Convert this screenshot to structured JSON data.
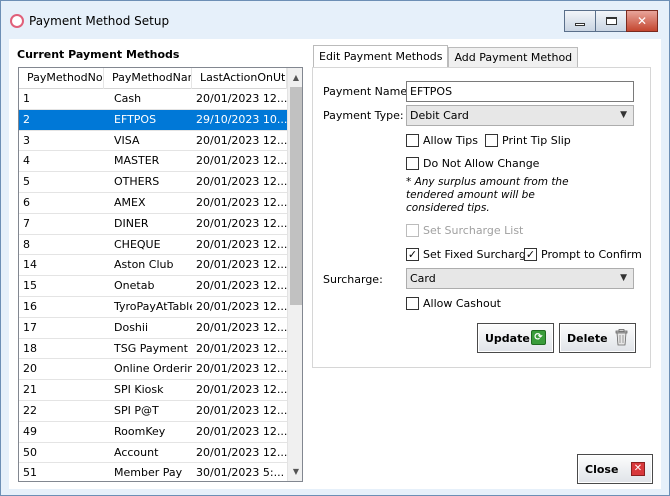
{
  "window": {
    "title": "Payment Method Setup",
    "minimize": "minimize-button",
    "maximize": "maximize-button",
    "close": "close-window-button"
  },
  "list": {
    "heading": "Current Payment Methods",
    "columns": [
      "PayMethodNo",
      "PayMethodName",
      "LastActionOnUtc"
    ],
    "rows": [
      [
        "1",
        "Cash",
        "20/01/2023 12..."
      ],
      [
        "2",
        "EFTPOS",
        "29/10/2023 10..."
      ],
      [
        "3",
        "VISA",
        "20/01/2023 12..."
      ],
      [
        "4",
        "MASTER",
        "20/01/2023 12..."
      ],
      [
        "5",
        "OTHERS",
        "20/01/2023 12..."
      ],
      [
        "6",
        "AMEX",
        "20/01/2023 12..."
      ],
      [
        "7",
        "DINER",
        "20/01/2023 12..."
      ],
      [
        "8",
        "CHEQUE",
        "20/01/2023 12..."
      ],
      [
        "14",
        "Aston Club",
        "20/01/2023 12..."
      ],
      [
        "15",
        "Onetab",
        "20/01/2023 12..."
      ],
      [
        "16",
        "TyroPayAtTable",
        "20/01/2023 12..."
      ],
      [
        "17",
        "Doshii",
        "20/01/2023 12..."
      ],
      [
        "18",
        "TSG Payment",
        "20/01/2023 12..."
      ],
      [
        "20",
        "Online Ordering",
        "20/01/2023 12..."
      ],
      [
        "21",
        "SPI Kiosk",
        "20/01/2023 12..."
      ],
      [
        "22",
        "SPI P@T",
        "20/01/2023 12..."
      ],
      [
        "49",
        "RoomKey",
        "20/01/2023 12..."
      ],
      [
        "50",
        "Account",
        "20/01/2023 12..."
      ],
      [
        "51",
        "Member Pay",
        "30/01/2023 5:..."
      ]
    ],
    "selected_index": 1
  },
  "tabs": [
    {
      "label": "Edit Payment Methods",
      "active": true
    },
    {
      "label": "Add Payment Method",
      "active": false
    }
  ],
  "form": {
    "payment_name_label": "Payment Name:",
    "payment_name_value": "EFTPOS",
    "payment_type_label": "Payment Type:",
    "payment_type_value": "Debit Card",
    "allow_tips": "Allow Tips",
    "print_tip_slip": "Print Tip Slip",
    "do_not_allow_change": "Do Not Allow Change",
    "note": "* Any surplus amount from the tendered amount will be considered tips.",
    "set_surcharge_list": "Set Surcharge List",
    "set_fixed_surcharge": "Set Fixed Surcharge",
    "prompt_to_confirm": "Prompt to Confirm",
    "surcharge_label": "Surcharge:",
    "surcharge_value": "Card",
    "allow_cashout": "Allow Cashout",
    "update_button": "Update",
    "delete_button": "Delete"
  },
  "close_button": "Close",
  "icons": {
    "check_glyph": "✓",
    "dropdown_glyph": "⌄"
  }
}
